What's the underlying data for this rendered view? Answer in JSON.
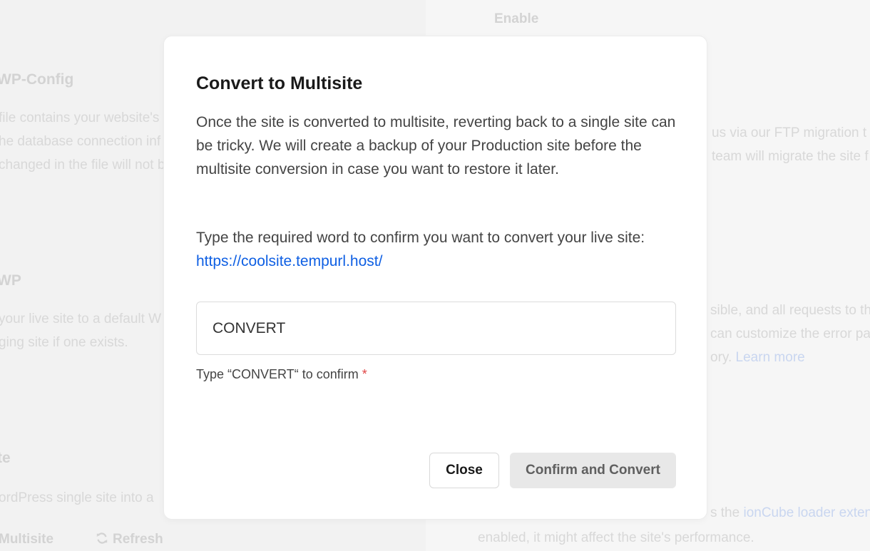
{
  "background": {
    "enable_label": "Enable",
    "wp_config_heading": "WP-Config",
    "wp_config_lines": [
      "file contains your website's",
      "he database connection inf",
      "changed in the file will not b"
    ],
    "wp_heading": "WP",
    "wp_lines": [
      "your live site to a default W",
      "ging site if one exists."
    ],
    "te_heading": "te",
    "te_line": "ordPress single site into a",
    "multisite_label": "Multisite",
    "refresh_label": "Refresh",
    "right_lines": {
      "ftp1": "us via our FTP migration t",
      "ftp2": "team will migrate the site f",
      "vis1": "sible, and all requests to th",
      "vis2": "can customize the error pag",
      "vis3_text": "ory.",
      "learn_more": "Learn more",
      "ion_text": "s the",
      "ion_link": "ionCube loader extens",
      "perf": "enabled, it might affect the site's performance."
    }
  },
  "modal": {
    "title": "Convert to Multisite",
    "description": "Once the site is converted to multisite, reverting back to a single site can be tricky. We will create a backup of your Production site before the multisite conversion in case you want to restore it later.",
    "confirm_prefix": "Type the required word to confirm you want to convert your live site:",
    "site_url": "https://coolsite.tempurl.host/",
    "input_value": "CONVERT",
    "hint": "Type “CONVERT“ to confirm",
    "required_mark": "*",
    "close_label": "Close",
    "confirm_label": "Confirm and Convert"
  }
}
